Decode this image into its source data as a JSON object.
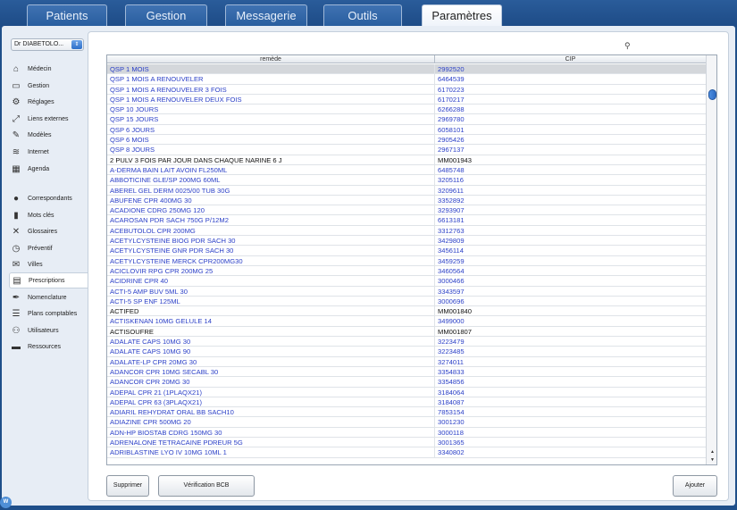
{
  "tabs": [
    {
      "label": "Patients",
      "active": false
    },
    {
      "label": "Gestion",
      "active": false
    },
    {
      "label": "Messagerie",
      "active": false
    },
    {
      "label": "Outils",
      "active": false
    },
    {
      "label": "Paramètres",
      "active": true
    }
  ],
  "sidebar": {
    "doctor_select": "Dr DIABETOLO...",
    "items": [
      {
        "label": "Médecin",
        "icon": "house-icon"
      },
      {
        "label": "Gestion",
        "icon": "drawer-icon"
      },
      {
        "label": "Réglages",
        "icon": "gear-icon"
      },
      {
        "label": "Liens externes",
        "icon": "expand-icon"
      },
      {
        "label": "Modèles",
        "icon": "pencil-square-icon"
      },
      {
        "label": "Internet",
        "icon": "wifi-icon"
      },
      {
        "label": "Agenda",
        "icon": "calendar-icon"
      },
      {
        "label": "Correspondants",
        "icon": "person-icon"
      },
      {
        "label": "Mots clés",
        "icon": "bars-chart-icon"
      },
      {
        "label": "Glossaires",
        "icon": "tools-icon"
      },
      {
        "label": "Préventif",
        "icon": "clock-icon"
      },
      {
        "label": "Villes",
        "icon": "envelope-icon"
      },
      {
        "label": "Prescriptions",
        "icon": "list-form-icon",
        "active": true
      },
      {
        "label": "Nomenclature",
        "icon": "pen-icon"
      },
      {
        "label": "Plans comptables",
        "icon": "ledger-icon"
      },
      {
        "label": "Utilisateurs",
        "icon": "users-icon"
      },
      {
        "label": "Ressources",
        "icon": "car-icon"
      }
    ]
  },
  "search": {
    "placeholder": ""
  },
  "table": {
    "headers": [
      "remède",
      "CIP"
    ],
    "rows": [
      {
        "name": "QSP 1 MOIS",
        "cip": "2992520",
        "color": "blue",
        "selected": true
      },
      {
        "name": "QSP 1 MOIS A RENOUVELER",
        "cip": "6464539",
        "color": "blue"
      },
      {
        "name": "QSP 1 MOIS A RENOUVELER 3 FOIS",
        "cip": "6170223",
        "color": "blue"
      },
      {
        "name": "QSP 1 MOIS A RENOUVELER DEUX FOIS",
        "cip": "6170217",
        "color": "blue"
      },
      {
        "name": "QSP 10 JOURS",
        "cip": "6266288",
        "color": "blue"
      },
      {
        "name": "QSP 15 JOURS",
        "cip": "2969780",
        "color": "blue"
      },
      {
        "name": "QSP 6 JOURS",
        "cip": "6058101",
        "color": "blue"
      },
      {
        "name": "QSP 6 MOIS",
        "cip": "2905426",
        "color": "blue"
      },
      {
        "name": "QSP 8 JOURS",
        "cip": "2967137",
        "color": "blue"
      },
      {
        "name": "2 PULV 3 FOIS PAR JOUR DANS CHAQUE NARINE 6 J",
        "cip": "MM001943",
        "color": "black"
      },
      {
        "name": "A-DERMA BAIN LAIT AVOIN FL250ML",
        "cip": "6485748",
        "color": "blue"
      },
      {
        "name": "ABBOTICINE GLE/SP 200MG 60ML",
        "cip": "3205116",
        "color": "blue"
      },
      {
        "name": "ABEREL GEL DERM 0025/00 TUB 30G",
        "cip": "3209611",
        "color": "blue"
      },
      {
        "name": "ABUFENE CPR 400MG 30",
        "cip": "3352892",
        "color": "blue"
      },
      {
        "name": "ACADIONE CDRG 250MG 120",
        "cip": "3293907",
        "color": "blue"
      },
      {
        "name": "ACAROSAN PDR SACH 750G P/12M2",
        "cip": "6613181",
        "color": "blue"
      },
      {
        "name": "ACEBUTOLOL CPR 200MG",
        "cip": "3312763",
        "color": "blue"
      },
      {
        "name": "ACETYLCYSTEINE BIOG PDR SACH 30",
        "cip": "3429809",
        "color": "blue"
      },
      {
        "name": "ACETYLCYSTEINE GNR PDR SACH 30",
        "cip": "3456114",
        "color": "blue"
      },
      {
        "name": "ACETYLCYSTEINE MERCK CPR200MG30",
        "cip": "3459259",
        "color": "blue"
      },
      {
        "name": "ACICLOVIR RPG CPR 200MG 25",
        "cip": "3460564",
        "color": "blue"
      },
      {
        "name": "ACIDRINE CPR 40",
        "cip": "3000466",
        "color": "blue"
      },
      {
        "name": "ACTI-5 AMP BUV 5ML 30",
        "cip": "3343597",
        "color": "blue"
      },
      {
        "name": "ACTI-5 SP ENF 125ML",
        "cip": "3000696",
        "color": "blue"
      },
      {
        "name": "ACTIFED",
        "cip": "MM001840",
        "color": "black"
      },
      {
        "name": "ACTISKENAN 10MG GELULE 14",
        "cip": "3499000",
        "color": "blue"
      },
      {
        "name": "ACTISOUFRE",
        "cip": "MM001807",
        "color": "black"
      },
      {
        "name": "ADALATE CAPS 10MG 30",
        "cip": "3223479",
        "color": "blue"
      },
      {
        "name": "ADALATE CAPS 10MG 90",
        "cip": "3223485",
        "color": "blue"
      },
      {
        "name": "ADALATE-LP CPR 20MG 30",
        "cip": "3274011",
        "color": "blue"
      },
      {
        "name": "ADANCOR CPR 10MG SECABL 30",
        "cip": "3354833",
        "color": "blue"
      },
      {
        "name": "ADANCOR CPR 20MG 30",
        "cip": "3354856",
        "color": "blue"
      },
      {
        "name": "ADEPAL CPR 21 (1PLAQX21)",
        "cip": "3184064",
        "color": "blue"
      },
      {
        "name": "ADEPAL CPR 63 (3PLAQX21)",
        "cip": "3184087",
        "color": "blue"
      },
      {
        "name": "ADIARIL REHYDRAT ORAL BB SACH10",
        "cip": "7853154",
        "color": "blue"
      },
      {
        "name": "ADIAZINE CPR 500MG 20",
        "cip": "3001230",
        "color": "blue"
      },
      {
        "name": "ADN-HP BIOSTAB CDRG 150MG 30",
        "cip": "3000118",
        "color": "blue"
      },
      {
        "name": "ADRENALONE TETRACAINE PDREUR 5G",
        "cip": "3001365",
        "color": "blue"
      },
      {
        "name": "ADRIBLASTINE LYO IV 10MG 10ML 1",
        "cip": "3340802",
        "color": "blue"
      }
    ]
  },
  "buttons": {
    "delete": "Supprimer",
    "bcb_check": "Vérification BCB",
    "add": "Ajouter"
  },
  "corner_logo": "W"
}
